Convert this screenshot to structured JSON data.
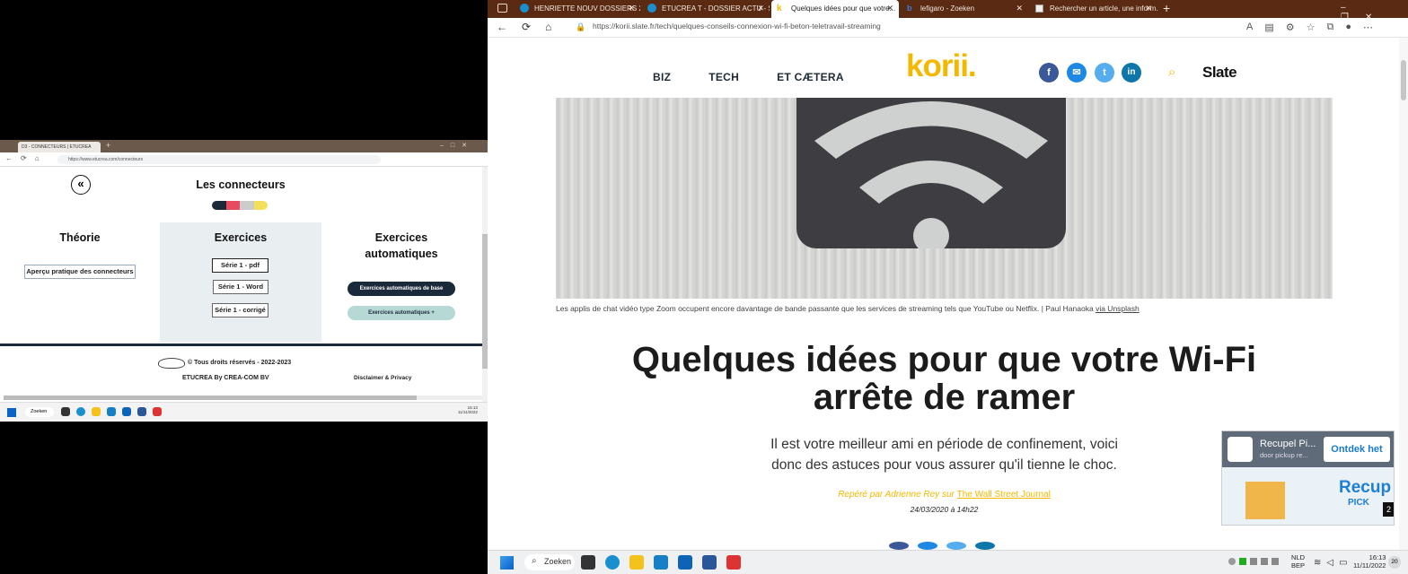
{
  "left": {
    "tab_title": "D3 - CONNECTEURS | ETUCREA",
    "url": "https://www.etucrea.com/connecteurs",
    "page_title": "Les connecteurs",
    "theory": {
      "heading": "Théorie",
      "btn": "Aperçu pratique des connecteurs"
    },
    "exercises": {
      "heading": "Exercices",
      "btns": [
        "Série 1 - pdf",
        "Série 1 - Word",
        "Série 1 - corrigé"
      ]
    },
    "auto": {
      "heading_line1": "Exercices",
      "heading_line2": "automatiques",
      "btn_base": "Exercices automatiques de base",
      "btn_plus": "Exercices automatiques +"
    },
    "footer": {
      "copyright": "© Tous droits réservés - 2022-2023",
      "company": "ETUCREA By CREA-COM BV",
      "disclaimer": "Disclaimer & Privacy"
    },
    "taskbar": {
      "search": "Zoeken",
      "time": "16:13",
      "date": "11/11/2022"
    }
  },
  "right": {
    "tabs": [
      {
        "title": "HENRIETTE NOUV DOSSIERS 20..."
      },
      {
        "title": "ETUCREA T - DOSSIER ACTU - S..."
      },
      {
        "title": "Quelques idées pour que votre..."
      },
      {
        "title": "lefigaro - Zoeken"
      },
      {
        "title": "Rechercher un article, une inform..."
      }
    ],
    "url": "https://korii.slate.fr/tech/quelques-conseils-connexion-wi-fi-beton-teletravail-streaming",
    "nav": [
      "BIZ",
      "TECH",
      "ET CÆTERA"
    ],
    "logo": "korii.",
    "slate": "Slate",
    "caption": "Les applis de chat vidéo type Zoom occupent encore davantage de bande passante que les services de streaming tels que YouTube ou Netflix. | Paul Hanaoka",
    "caption_link": "via Unsplash",
    "headline_line1": "Quelques idées pour que votre Wi-Fi",
    "headline_line2": "arrête de ramer",
    "subtitle_line1": "Il est votre meilleur ami en période de confinement, voici",
    "subtitle_line2": "donc des astuces pour vous assurer qu'il tienne le choc.",
    "byline": "Repéré par Adrienne Rey sur",
    "byline_link": "The Wall Street Journal",
    "date": "24/03/2020 à 14h22",
    "ad": {
      "title": "Recupel Pi...",
      "sub": "door pickup re...",
      "cta": "Ontdek het",
      "brand": "Recup",
      "brand2": "PICK",
      "count": "2"
    },
    "taskbar": {
      "search": "Zoeken",
      "lang1": "NLD",
      "lang2": "BEP",
      "time": "16:13",
      "date": "11/11/2022",
      "badge": "20"
    }
  },
  "colors": {
    "korii_yellow": "#f5b800",
    "navy": "#1b2a3a",
    "tab_brown": "#5a2a12",
    "mint": "#b7d9d5",
    "fb": "#3b5998",
    "messenger": "#1e88e5",
    "twitter": "#55acee",
    "linkedin": "#0e76a8"
  }
}
